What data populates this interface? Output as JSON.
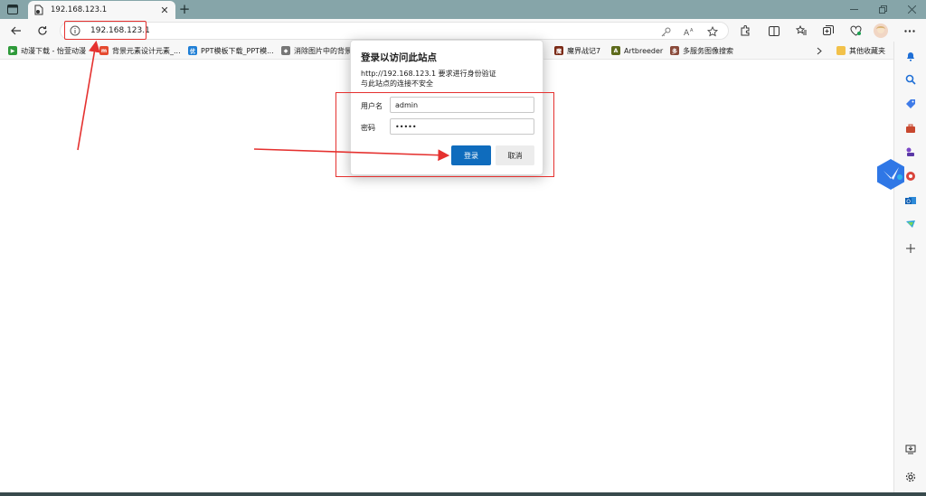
{
  "tab": {
    "title": "192.168.123.1"
  },
  "toolbar": {
    "address": "192.168.123.1"
  },
  "bookmarks": [
    {
      "label": "动漫下载 - 怡萱动漫",
      "color": "#2e9a3a"
    },
    {
      "label": "背景元素设计元素_...",
      "color": "#e54a2f"
    },
    {
      "label": "PPT模板下载_PPT模...",
      "color": "#1f7fd6"
    },
    {
      "label": "消除图片中的背景",
      "color": "#777777"
    },
    {
      "label": "魔界战记7",
      "color": "#7b2a16"
    },
    {
      "label": "Artbreeder",
      "color": "#5e6b1c"
    },
    {
      "label": "多服务图像搜索",
      "color": "#8a4a3a"
    }
  ],
  "other_bookmarks": "其他收藏夹",
  "dialog": {
    "title": "登录以访问此站点",
    "url_line": "http://192.168.123.1 要求进行身份验证",
    "warning": "与此站点的连接不安全",
    "username_label": "用户名",
    "username_value": "admin",
    "password_label": "密码",
    "password_value": "•••••",
    "login_button": "登录",
    "cancel_button": "取消"
  },
  "colors": {
    "tabstrip": "#86a5a9",
    "accent": "#0f6cbd",
    "annotation": "#e5312f"
  }
}
